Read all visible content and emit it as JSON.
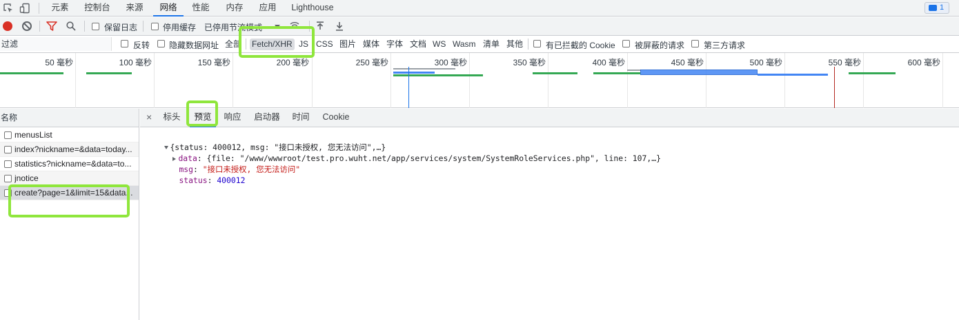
{
  "top_tabs": [
    {
      "label": "元素"
    },
    {
      "label": "控制台"
    },
    {
      "label": "来源"
    },
    {
      "label": "网络"
    },
    {
      "label": "性能"
    },
    {
      "label": "内存"
    },
    {
      "label": "应用"
    },
    {
      "label": "Lighthouse"
    }
  ],
  "active_top_tab": "网络",
  "issues_badge": {
    "count": "1"
  },
  "toolbar": {
    "preserve_log": "保留日志",
    "disable_cache": "停用缓存",
    "throttling": "已停用节流模式"
  },
  "filter": {
    "placeholder": "过滤",
    "invert": "反转",
    "hide_data_urls": "隐藏数据网址",
    "all": "全部",
    "types": [
      "Fetch/XHR",
      "JS",
      "CSS",
      "图片",
      "媒体",
      "字体",
      "文档",
      "WS",
      "Wasm",
      "清单",
      "其他"
    ],
    "selected_type": "Fetch/XHR",
    "blocked_cookies": "有已拦截的 Cookie",
    "blocked_requests": "被屏蔽的请求",
    "third_party": "第三方请求"
  },
  "timeline": {
    "ticks": [
      "50 毫秒",
      "100 毫秒",
      "150 毫秒",
      "200 毫秒",
      "250 毫秒",
      "300 毫秒",
      "350 毫秒",
      "400 毫秒",
      "450 毫秒",
      "500 毫秒",
      "550 毫秒",
      "600 毫秒"
    ]
  },
  "requests": {
    "column_header": "名称",
    "items": [
      {
        "name": "menusList"
      },
      {
        "name": "index?nickname=&data=today..."
      },
      {
        "name": "statistics?nickname=&data=to..."
      },
      {
        "name": "jnotice"
      },
      {
        "name": "create?page=1&limit=15&data..."
      }
    ]
  },
  "detail_tabs": [
    {
      "label": "标头"
    },
    {
      "label": "预览"
    },
    {
      "label": "响应"
    },
    {
      "label": "启动器"
    },
    {
      "label": "时间"
    },
    {
      "label": "Cookie"
    }
  ],
  "active_detail_tab": "预览",
  "preview": {
    "summary": "{status: 400012, msg: \"接口未授权, 您无法访问\",…}",
    "data_key": "data",
    "data_value": "{file: \"/www/wwwroot/test.pro.wuht.net/app/services/system/SystemRoleServices.php\", line: 107,…}",
    "msg_key": "msg",
    "msg_value": "\"接口未授权, 您无法访问\"",
    "status_key": "status",
    "status_value": "400012"
  },
  "colors": {
    "accent": "#1a73e8",
    "record": "#d93025",
    "highlight": "#8fe63c",
    "waterfall_green": "#34a853",
    "waterfall_blue": "#4285f4"
  }
}
